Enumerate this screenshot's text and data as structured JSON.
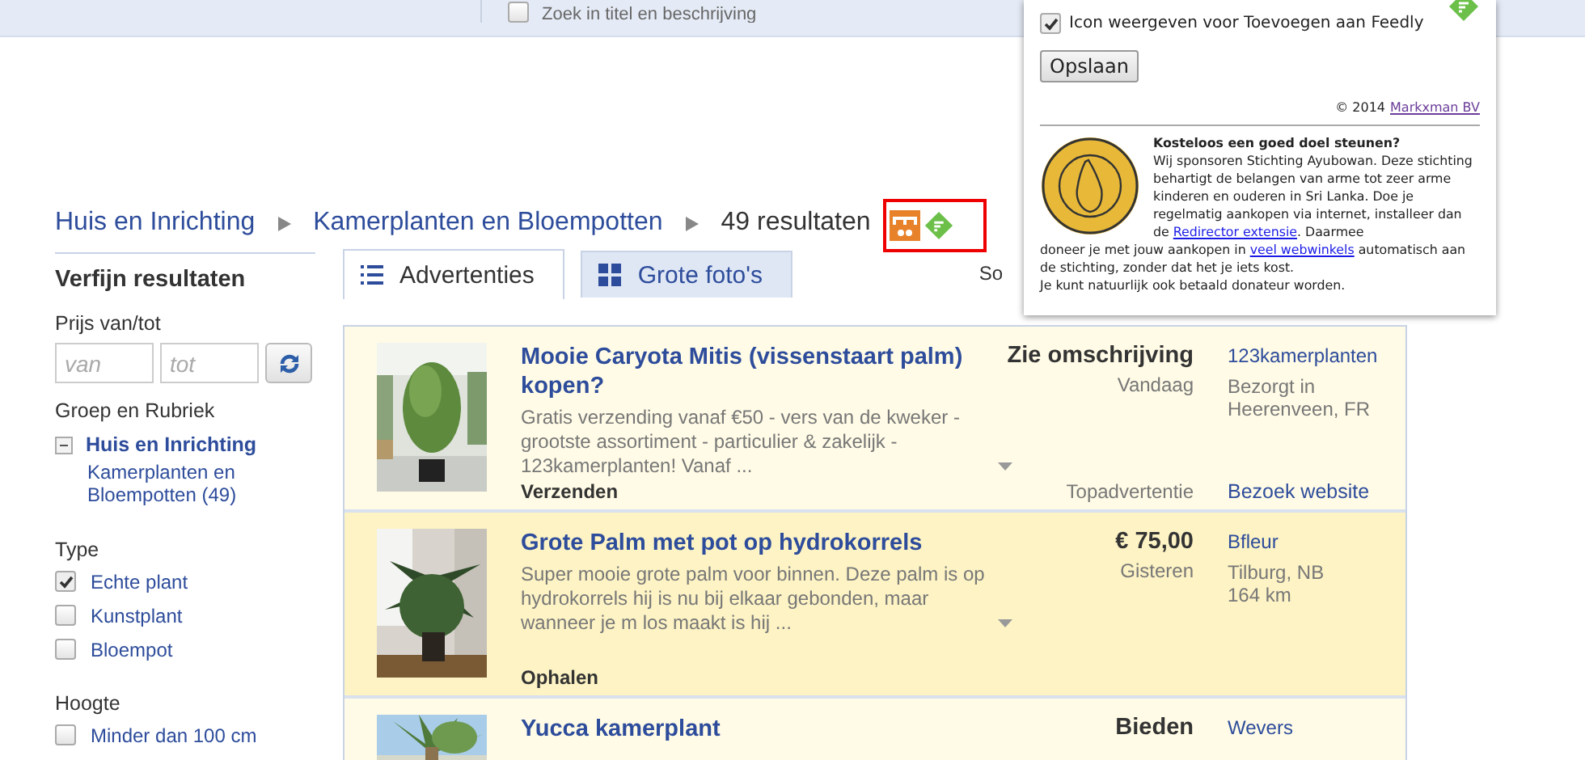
{
  "top_bar": {
    "search_option": {
      "label": "Zoek in titel en beschrijving",
      "checked": false
    }
  },
  "popup": {
    "feedly_option": {
      "label": "Icon weergeven voor Toevoegen aan Feedly",
      "checked": true
    },
    "save_button": "Opslaan",
    "copyright": "© 2014",
    "copyright_link": "Markxman BV",
    "charity_heading": "Kosteloos een goed doel steunen?",
    "charity_text": [
      {
        "kind": "text",
        "text": "Wij sponsoren Stichting Ayubowan. Deze stichting behartigt de belangen van arme tot zeer arme kinderen en ouderen in Sri Lanka. Doe je regelmatig aankopen via internet, installeer dan de "
      },
      {
        "kind": "link",
        "text": "Redirector extensie"
      },
      {
        "kind": "text",
        "text": ". Daarmee"
      }
    ],
    "charity_text_continued": [
      {
        "kind": "text",
        "text": "doneer je met jouw aankopen in "
      },
      {
        "kind": "link",
        "text": "veel webwinkels"
      },
      {
        "kind": "text",
        "text": " automatisch aan de stichting, zonder dat het je iets kost."
      }
    ],
    "charity_footer": "Je kunt natuurlijk ook betaald donateur worden."
  },
  "breadcrumb": {
    "items": [
      "Huis en Inrichting",
      "Kamerplanten en Bloempotten"
    ],
    "result_count": "49 resultaten"
  },
  "sidebar": {
    "title": "Verfijn resultaten",
    "price": {
      "label": "Prijs van/tot",
      "from_placeholder": "van",
      "to_placeholder": "tot"
    },
    "group": {
      "label": "Groep en Rubriek",
      "category": {
        "label": "Huis en Inrichting",
        "expanded": true
      },
      "subcategory": "Kamerplanten en Bloempotten",
      "count": "(49)"
    },
    "filters": [
      {
        "label": "Type",
        "options": [
          {
            "label": "Echte plant",
            "checked": true
          },
          {
            "label": "Kunstplant",
            "checked": false
          },
          {
            "label": "Bloempot",
            "checked": false
          }
        ]
      },
      {
        "label": "Hoogte",
        "options": [
          {
            "label": "Minder dan 100 cm",
            "checked": false
          }
        ]
      }
    ]
  },
  "tabs": [
    {
      "label": "Advertenties",
      "selected": true,
      "kind": "list"
    },
    {
      "label": "Grote foto's",
      "selected": false,
      "kind": "grid"
    }
  ],
  "sort_label": "So",
  "listings": [
    {
      "title": "Mooie Caryota Mitis (vissenstaart palm) kopen?",
      "description": "Gratis verzending vanaf €50 - vers van de kweker - grootste assortiment - particulier & zakelijk - 123kamerplanten! Vanaf ...",
      "price": "Zie omschrijving",
      "date": "Vandaag",
      "seller": "123kamerplanten",
      "location": "Bezorgt in Heerenveen, FR",
      "delivery": "Verzenden",
      "footer_note": "Topadvertentie",
      "footer_link": "Bezoek website",
      "highlighted": false
    },
    {
      "title": "Grote Palm met pot op hydrokorrels",
      "description": "Super mooie grote palm voor binnen.  Deze palm is op hydrokorrels   hij is nu bij elkaar gebonden, maar wanneer je m los maakt is hij ...",
      "price": "€ 75,00",
      "date": "Gisteren",
      "seller": "Bfleur",
      "location": "Tilburg, NB",
      "distance": "164 km",
      "delivery": "Ophalen",
      "highlighted": true
    },
    {
      "title": "Yucca kamerplant",
      "price": "Bieden",
      "seller": "Wevers",
      "highlighted": false
    }
  ]
}
